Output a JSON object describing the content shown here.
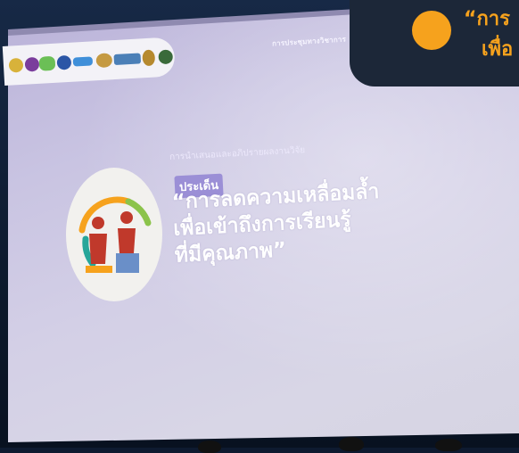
{
  "banner": {
    "line1": "“การ",
    "line2": "เพื่อ",
    "accent_color": "#f6a21d",
    "bg_color": "#1c2738"
  },
  "screen": {
    "conference_text": "การประชุมทางวิชาการ",
    "slide": {
      "subtitle": "การนำเสนอและอภิปรายผลงานวิจัย",
      "tag": "ประเด็น",
      "title_lines": [
        "“การลดความเหลื่อมล้ำ",
        "เพื่อเข้าถึงการเรียนรู้",
        "ที่มีคุณภาพ”"
      ]
    }
  }
}
